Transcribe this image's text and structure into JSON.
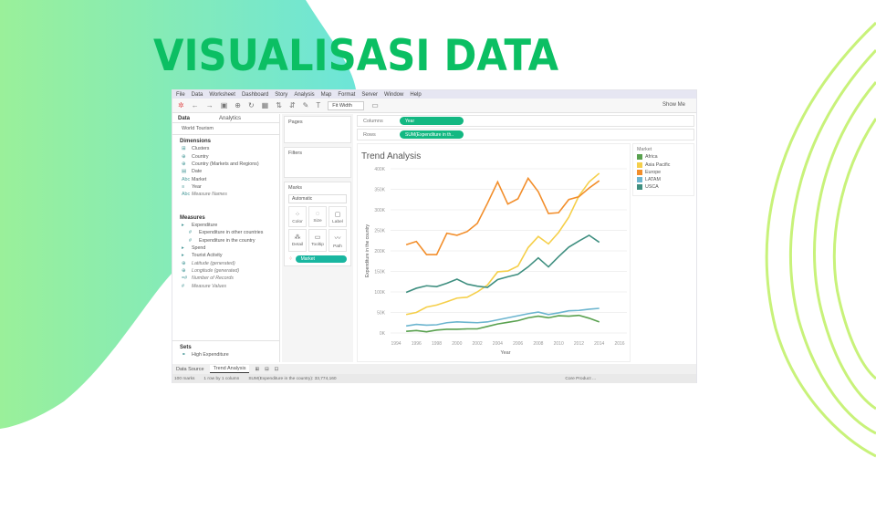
{
  "slide": {
    "title": "VISUALISASI DATA"
  },
  "menu": [
    "File",
    "Data",
    "Worksheet",
    "Dashboard",
    "Story",
    "Analysis",
    "Map",
    "Format",
    "Server",
    "Window",
    "Help"
  ],
  "toolbar": {
    "fit": "Fit Width",
    "show_me": "Show Me"
  },
  "data_pane": {
    "tab_data": "Data",
    "tab_analytics": "Analytics",
    "source": "World Tourism",
    "dimensions_label": "Dimensions",
    "dimensions": [
      {
        "icon": "⊞",
        "label": "Clusters"
      },
      {
        "icon": "⊕",
        "label": "Country"
      },
      {
        "icon": "⊕",
        "label": "Country (Markets and Regions)"
      },
      {
        "icon": "▤",
        "label": "Date"
      },
      {
        "icon": "Abc",
        "label": "Market"
      },
      {
        "icon": "≡",
        "label": "Year"
      },
      {
        "icon": "Abc",
        "label": "Measure Names"
      }
    ],
    "measures_label": "Measures",
    "measures": [
      {
        "icon": "▸",
        "label": "Expenditure"
      },
      {
        "icon": "#",
        "label": "Expenditure in other countries"
      },
      {
        "icon": "#",
        "label": "Expenditure in the country"
      },
      {
        "icon": "▸",
        "label": "Spend"
      },
      {
        "icon": "▸",
        "label": "Tourist Activity"
      },
      {
        "icon": "⊕",
        "label": "Latitude (generated)"
      },
      {
        "icon": "⊕",
        "label": "Longitude (generated)"
      },
      {
        "icon": "=#",
        "label": "Number of Records"
      },
      {
        "icon": "#",
        "label": "Measure Values"
      }
    ],
    "sets_label": "Sets",
    "sets": [
      "High Expenditure"
    ]
  },
  "shelves": {
    "pages": "Pages",
    "filters": "Filters",
    "marks": "Marks",
    "mark_type": "Automatic",
    "mark_buttons": [
      "Color",
      "Size",
      "Label",
      "Detail",
      "Tooltip",
      "Path"
    ],
    "color_pill": "Market",
    "columns_label": "Columns",
    "columns_pill": "Year",
    "rows_label": "Rows",
    "rows_pill": "SUM(Expenditure in th.."
  },
  "legend": {
    "title": "Market"
  },
  "sheet_tabs": {
    "data_source": "Data Source",
    "sheet": "Trend Analysis"
  },
  "status": {
    "marks": "100 marks",
    "rows": "1 row by 1 column",
    "sum": "SUM(Expenditure in the country): 33,774,160",
    "user": "Core Product ..."
  },
  "chart_data": {
    "type": "line",
    "title": "Trend Analysis",
    "xlabel": "Year",
    "ylabel": "Expenditure in the country",
    "x": [
      1995,
      1996,
      1997,
      1998,
      1999,
      2000,
      2001,
      2002,
      2003,
      2004,
      2005,
      2006,
      2007,
      2008,
      2009,
      2010,
      2011,
      2012,
      2013,
      2014
    ],
    "xticks": [
      "1994",
      "1996",
      "1998",
      "2000",
      "2002",
      "2004",
      "2006",
      "2008",
      "2010",
      "2012",
      "2014",
      "2016"
    ],
    "yticks": [
      "0K",
      "50K",
      "100K",
      "150K",
      "200K",
      "250K",
      "300K",
      "350K",
      "400K"
    ],
    "ylim": [
      0,
      400
    ],
    "xlim": [
      1994,
      2016
    ],
    "legend_position": "right",
    "y_unit": "K",
    "series": [
      {
        "name": "Africa",
        "color": "#59a14f",
        "values": [
          4,
          6,
          3,
          7,
          9,
          9,
          10,
          10,
          16,
          22,
          26,
          30,
          37,
          41,
          37,
          42,
          41,
          43,
          36,
          27
        ]
      },
      {
        "name": "Asia Pacific",
        "color": "#f5cf4a",
        "values": [
          45,
          50,
          63,
          68,
          76,
          85,
          87,
          100,
          117,
          149,
          151,
          163,
          208,
          235,
          217,
          245,
          282,
          334,
          368,
          389
        ]
      },
      {
        "name": "Europe",
        "color": "#f28e2b",
        "values": [
          215,
          223,
          191,
          191,
          243,
          238,
          247,
          267,
          316,
          368,
          314,
          327,
          377,
          344,
          291,
          293,
          325,
          332,
          353,
          371
        ]
      },
      {
        "name": "LATAM",
        "color": "#6cb5cf",
        "values": [
          17,
          21,
          19,
          20,
          25,
          27,
          26,
          25,
          27,
          32,
          37,
          42,
          47,
          51,
          45,
          49,
          54,
          55,
          58,
          60
        ]
      },
      {
        "name": "USCA",
        "color": "#3f8f80",
        "values": [
          99,
          109,
          115,
          113,
          121,
          131,
          119,
          114,
          111,
          130,
          137,
          143,
          161,
          183,
          161,
          186,
          209,
          224,
          238,
          221
        ]
      }
    ]
  }
}
